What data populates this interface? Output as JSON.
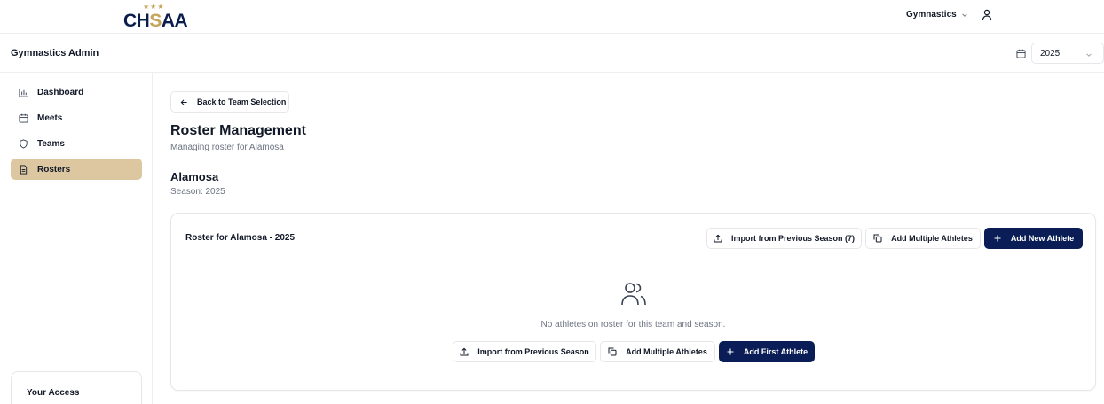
{
  "header": {
    "logo": {
      "part1": "CH",
      "part2": "S",
      "part3": "AA",
      "stars": "★★★"
    },
    "sport_menu": "Gymnastics",
    "colors": {
      "brand_navy": "#0a1d56",
      "brand_gold": "#c4a55a",
      "active_nav": "#dcc7a1"
    }
  },
  "subheader": {
    "title": "Gymnastics Admin",
    "year": "2025"
  },
  "sidebar": {
    "items": [
      {
        "label": "Dashboard",
        "icon": "bar-chart-icon",
        "active": false
      },
      {
        "label": "Meets",
        "icon": "calendar-icon",
        "active": false
      },
      {
        "label": "Teams",
        "icon": "shield-icon",
        "active": false
      },
      {
        "label": "Rosters",
        "icon": "file-icon",
        "active": true
      }
    ],
    "access_card": "Your Access"
  },
  "main": {
    "back_button": "Back to Team Selection",
    "page_title": "Roster Management",
    "page_subtitle": "Managing roster for Alamosa",
    "team_name": "Alamosa",
    "season": "Season: 2025",
    "card": {
      "title": "Roster for Alamosa - 2025",
      "import_previous_label": "Import from Previous Season (7)",
      "add_multiple_label": "Add Multiple Athletes",
      "add_new_label": "Add New Athlete",
      "empty_icon": "users-icon",
      "empty_text": "No athletes on roster for this team and season.",
      "empty_import_label": "Import from Previous Season",
      "empty_add_multiple_label": "Add Multiple Athletes",
      "empty_add_first_label": "Add First Athlete"
    }
  }
}
